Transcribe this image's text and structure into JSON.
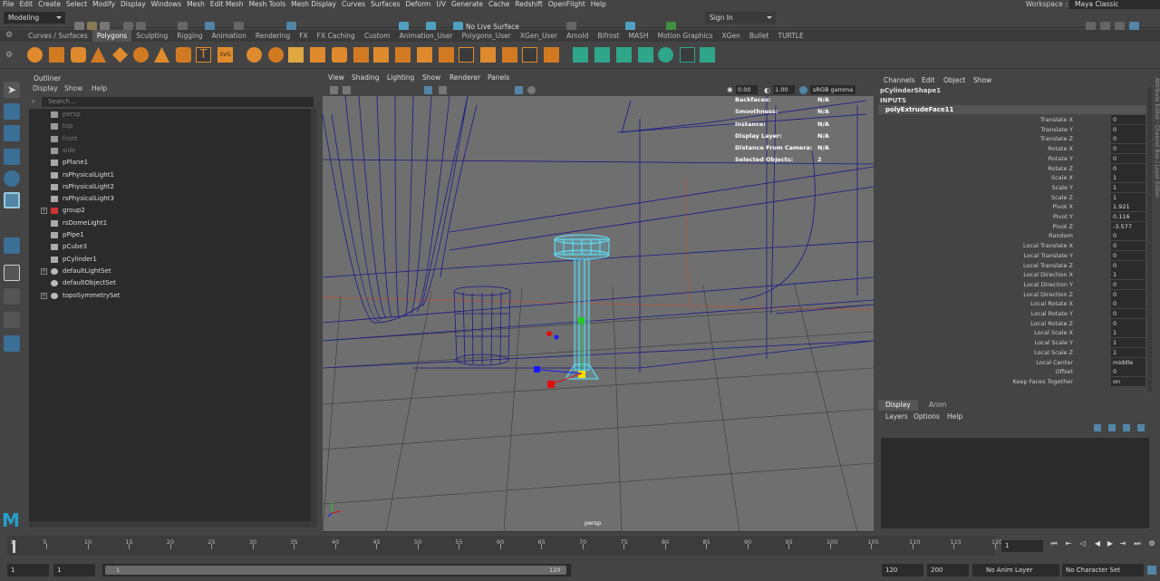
{
  "menubar": [
    "File",
    "Edit",
    "Create",
    "Select",
    "Modify",
    "Display",
    "Windows",
    "Mesh",
    "Edit Mesh",
    "Mesh Tools",
    "Mesh Display",
    "Curves",
    "Surfaces",
    "Deform",
    "UV",
    "Generate",
    "Cache",
    "Redshift",
    "OpenFlight",
    "Help"
  ],
  "workspace": {
    "label": "Workspace :",
    "value": "Maya Classic"
  },
  "status": {
    "mode": "Modeling",
    "live_surface": "No Live Surface",
    "sign_in": "Sign In"
  },
  "shelf_tabs": [
    "Curves / Surfaces",
    "Polygons",
    "Sculpting",
    "Rigging",
    "Animation",
    "Rendering",
    "FX",
    "FX Caching",
    "Custom",
    "Animation_User",
    "Polygons_User",
    "XGen_User",
    "Arnold",
    "Bifrost",
    "MASH",
    "Motion Graphics",
    "XGen",
    "Bullet",
    "TURTLE"
  ],
  "shelf_active": "Polygons",
  "outliner": {
    "title": "Outliner",
    "menu": [
      "Display",
      "Show",
      "Help"
    ],
    "search_placeholder": "Search...",
    "items": [
      {
        "name": "persp",
        "dim": true,
        "icon": "camera-icon",
        "expand": false
      },
      {
        "name": "top",
        "dim": true,
        "icon": "camera-icon",
        "expand": false
      },
      {
        "name": "front",
        "dim": true,
        "icon": "camera-icon",
        "expand": false
      },
      {
        "name": "side",
        "dim": true,
        "icon": "camera-icon",
        "expand": false
      },
      {
        "name": "pPlane1",
        "dim": false,
        "icon": "mesh-icon",
        "expand": false
      },
      {
        "name": "rsPhysicalLight1",
        "dim": false,
        "icon": "mesh-icon",
        "expand": false
      },
      {
        "name": "rsPhysicalLight2",
        "dim": false,
        "icon": "mesh-icon",
        "expand": false
      },
      {
        "name": "rsPhysicalLight3",
        "dim": false,
        "icon": "mesh-icon",
        "expand": false
      },
      {
        "name": "group2",
        "dim": false,
        "icon": "group-icon",
        "expand": true
      },
      {
        "name": "rsDomeLight1",
        "dim": false,
        "icon": "mesh-icon",
        "expand": false
      },
      {
        "name": "pPipe1",
        "dim": false,
        "icon": "mesh-icon",
        "expand": false
      },
      {
        "name": "pCube3",
        "dim": false,
        "icon": "mesh-icon",
        "expand": false
      },
      {
        "name": "pCylinder1",
        "dim": false,
        "icon": "mesh-icon",
        "expand": false
      },
      {
        "name": "defaultLightSet",
        "dim": false,
        "icon": "set-icon",
        "expand": true
      },
      {
        "name": "defaultObjectSet",
        "dim": false,
        "icon": "set-icon",
        "expand": false
      },
      {
        "name": "topoSymmetrySet",
        "dim": false,
        "icon": "set-icon",
        "expand": true
      }
    ]
  },
  "viewport": {
    "menu": [
      "View",
      "Shading",
      "Lighting",
      "Show",
      "Renderer",
      "Panels"
    ],
    "exposure": "0.00",
    "gamma": "1.00",
    "color_space": "sRGB gamma",
    "camera": "persp",
    "hud": [
      {
        "label": "Backfaces:",
        "value": "N/A"
      },
      {
        "label": "Smoothness:",
        "value": "N/A"
      },
      {
        "label": "Instance:",
        "value": "N/A"
      },
      {
        "label": "Display Layer:",
        "value": "N/A"
      },
      {
        "label": "Distance From Camera:",
        "value": "N/A"
      },
      {
        "label": "Selected Objects:",
        "value": "2"
      }
    ]
  },
  "channelbox": {
    "menu": [
      "Channels",
      "Edit",
      "Object",
      "Show"
    ],
    "shape": "pCylinderShape1",
    "inputs_label": "INPUTS",
    "node": "polyExtrudeFace11",
    "attrs": [
      {
        "label": "Translate X",
        "value": "0"
      },
      {
        "label": "Translate Y",
        "value": "0"
      },
      {
        "label": "Translate Z",
        "value": "0"
      },
      {
        "label": "Rotate X",
        "value": "0"
      },
      {
        "label": "Rotate Y",
        "value": "0"
      },
      {
        "label": "Rotate Z",
        "value": "0"
      },
      {
        "label": "Scale X",
        "value": "1"
      },
      {
        "label": "Scale Y",
        "value": "1"
      },
      {
        "label": "Scale Z",
        "value": "1"
      },
      {
        "label": "Pivot X",
        "value": "1.921"
      },
      {
        "label": "Pivot Y",
        "value": "0.116"
      },
      {
        "label": "Pivot Z",
        "value": "-3.577"
      },
      {
        "label": "Random",
        "value": "0"
      },
      {
        "label": "Local Translate X",
        "value": "0"
      },
      {
        "label": "Local Translate Y",
        "value": "0"
      },
      {
        "label": "Local Translate Z",
        "value": "0"
      },
      {
        "label": "Local Direction X",
        "value": "1"
      },
      {
        "label": "Local Direction Y",
        "value": "0"
      },
      {
        "label": "Local Direction Z",
        "value": "0"
      },
      {
        "label": "Local Rotate X",
        "value": "0"
      },
      {
        "label": "Local Rotate Y",
        "value": "0"
      },
      {
        "label": "Local Rotate Z",
        "value": "0"
      },
      {
        "label": "Local Scale X",
        "value": "1"
      },
      {
        "label": "Local Scale Y",
        "value": "1"
      },
      {
        "label": "Local Scale Z",
        "value": "1"
      },
      {
        "label": "Local Center",
        "value": "middle"
      },
      {
        "label": "Offset",
        "value": "0"
      },
      {
        "label": "Keep Faces Together",
        "value": "on"
      }
    ]
  },
  "layer_editor": {
    "tabs": [
      "Display",
      "Anim"
    ],
    "menu": [
      "Layers",
      "Options",
      "Help"
    ]
  },
  "time_slider": {
    "ticks": [
      1,
      5,
      10,
      15,
      20,
      25,
      30,
      35,
      40,
      45,
      50,
      55,
      60,
      65,
      70,
      75,
      80,
      85,
      90,
      95,
      100,
      105,
      110,
      115,
      120
    ],
    "current": "1"
  },
  "range_slider": {
    "start": "1",
    "range_start": "1",
    "range_bar_start": "1",
    "range_bar_end": "120",
    "range_end": "120",
    "end": "200",
    "anim_layer": "No Anim Layer",
    "char_set": "No Character Set"
  },
  "colors": {
    "bg": "#444444",
    "panel_dark": "#2b2b2b",
    "viewport": "#6f6f6f",
    "wire_blue": "#1a1a8a",
    "wire_cyan": "#5fe5ff",
    "accent": "#5285a6"
  }
}
